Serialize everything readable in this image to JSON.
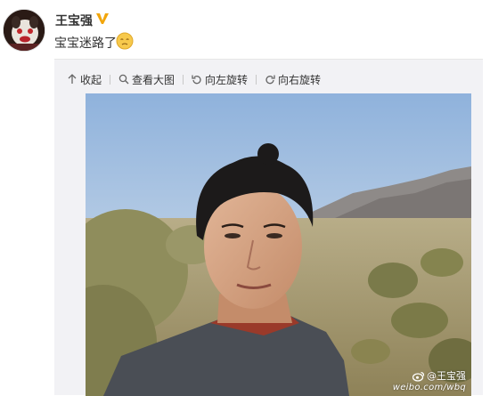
{
  "post": {
    "username": "王宝强",
    "verified_badge": "V",
    "text": "宝宝迷路了",
    "emoji_icon": "sad-face-emoji"
  },
  "toolbar": {
    "collapse_label": "收起",
    "view_large_label": "查看大图",
    "rotate_left_label": "向左旋转",
    "rotate_right_label": "向右旋转"
  },
  "photo": {
    "watermark_name": "@王宝强",
    "watermark_url": "weibo.com/wbq"
  },
  "colors": {
    "verified_badge": "#f2a60c",
    "panel_bg": "#f2f2f5",
    "text": "#333333"
  }
}
